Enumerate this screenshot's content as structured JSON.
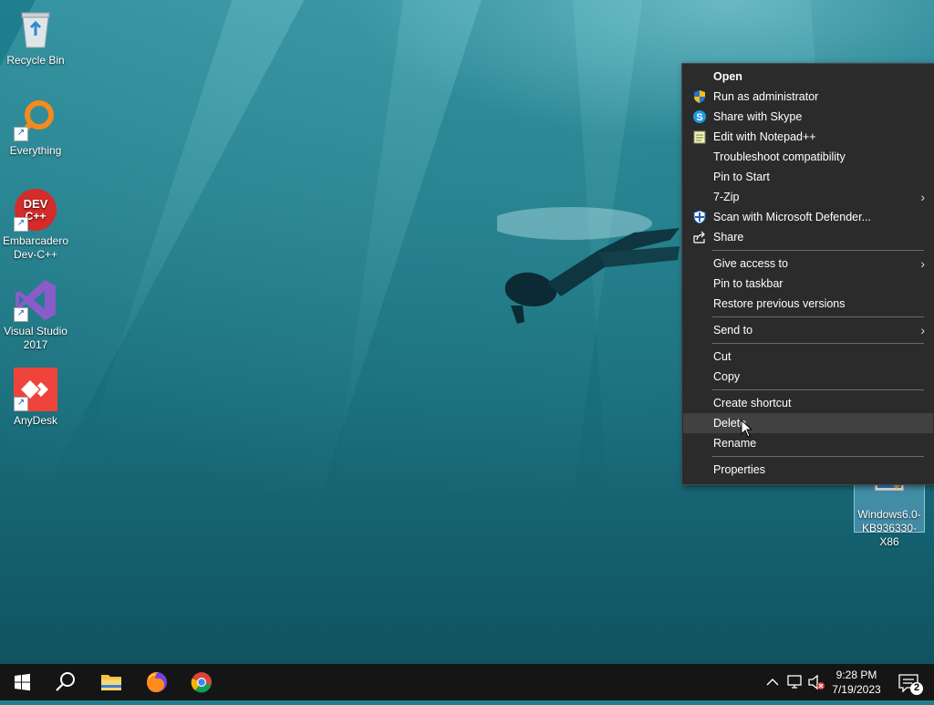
{
  "desktop": {
    "icons": [
      {
        "label": "Recycle Bin",
        "icon": "recycle-bin-icon"
      },
      {
        "label": "Everything",
        "icon": "everything-search-icon"
      },
      {
        "label": "Embarcadero Dev-C++",
        "icon": "devcpp-icon",
        "badge": "DEV C++"
      },
      {
        "label": "Visual Studio 2017",
        "icon": "visual-studio-icon"
      },
      {
        "label": "AnyDesk",
        "icon": "anydesk-icon"
      },
      {
        "label": "Windows6.0-KB936330-X86",
        "icon": "installer-icon",
        "selected": true
      }
    ]
  },
  "context_menu": {
    "items": [
      {
        "label": "Open",
        "bold": true
      },
      {
        "label": "Run as administrator",
        "icon": "uac-shield-icon"
      },
      {
        "label": "Share with Skype",
        "icon": "skype-icon"
      },
      {
        "label": "Edit with Notepad++",
        "icon": "notepadpp-icon"
      },
      {
        "label": "Troubleshoot compatibility"
      },
      {
        "label": "Pin to Start"
      },
      {
        "label": "7-Zip",
        "submenu": true
      },
      {
        "label": "Scan with Microsoft Defender...",
        "icon": "defender-icon"
      },
      {
        "label": "Share",
        "icon": "share-icon"
      },
      {
        "label": "Give access to",
        "submenu": true
      },
      {
        "label": "Pin to taskbar"
      },
      {
        "label": "Restore previous versions"
      },
      {
        "label": "Send to",
        "submenu": true
      },
      {
        "label": "Cut"
      },
      {
        "label": "Copy"
      },
      {
        "label": "Create shortcut"
      },
      {
        "label": "Delete",
        "hovered": true
      },
      {
        "label": "Rename"
      },
      {
        "label": "Properties"
      }
    ],
    "submenu_glyph": "›"
  },
  "taskbar": {
    "buttons": [
      "start-icon",
      "search-icon",
      "file-explorer-icon",
      "firefox-icon",
      "chrome-icon"
    ],
    "tray": {
      "chevron": "^",
      "time": "9:28 PM",
      "date": "7/19/2023",
      "notification_count": "2"
    }
  },
  "colors": {
    "menu_bg": "#2b2b2b",
    "menu_hover": "#414141",
    "taskbar_bg": "#151515",
    "anydesk": "#ef443b",
    "devcpp": "#d42b2b",
    "vs": "#8a5cc9"
  }
}
